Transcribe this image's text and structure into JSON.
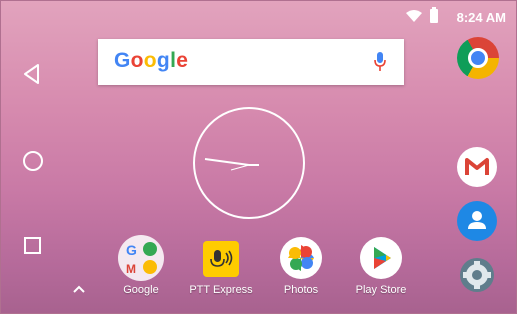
{
  "status_bar": {
    "time": "8:24 AM",
    "wifi_icon": "wifi-icon",
    "battery_icon": "battery-icon"
  },
  "nav": {
    "back_icon": "back-icon",
    "home_icon": "home-icon",
    "recents_icon": "recents-icon"
  },
  "search": {
    "logo_text": "Google",
    "mic_icon": "mic-icon"
  },
  "clock": {
    "type": "analog"
  },
  "side_apps": [
    {
      "name": "Chrome",
      "icon": "chrome-icon"
    },
    {
      "name": "Gmail",
      "icon": "gmail-icon"
    },
    {
      "name": "Contacts",
      "icon": "contacts-icon"
    },
    {
      "name": "Settings",
      "icon": "settings-icon"
    }
  ],
  "dock": {
    "apps": [
      {
        "label": "Google",
        "icon": "google-folder-icon"
      },
      {
        "label": "PTT Express",
        "icon": "ptt-express-icon"
      },
      {
        "label": "Photos",
        "icon": "photos-icon"
      },
      {
        "label": "Play Store",
        "icon": "play-store-icon"
      }
    ]
  },
  "colors": {
    "google_blue": "#4285f4",
    "google_red": "#ea4335",
    "google_yellow": "#fbbc05",
    "google_green": "#34a853"
  }
}
